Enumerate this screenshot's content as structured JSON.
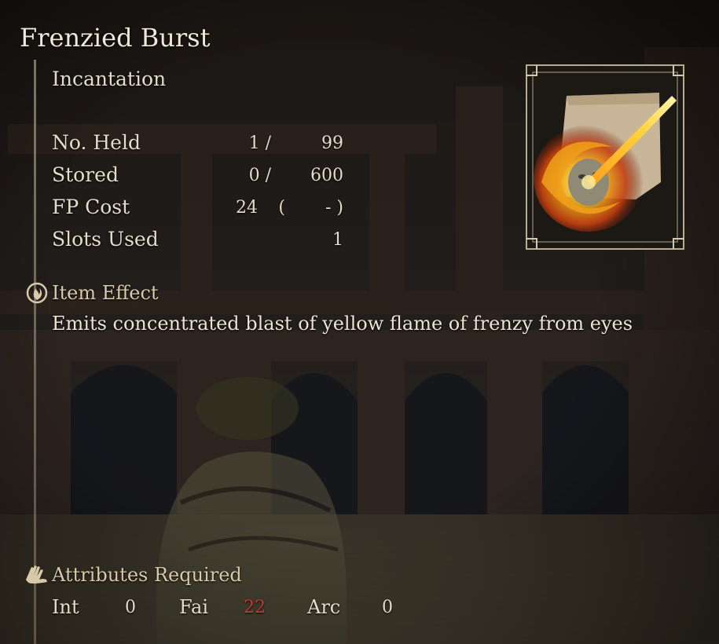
{
  "item": {
    "name": "Frenzied Burst",
    "category": "Incantation"
  },
  "stats": [
    {
      "label": "No. Held",
      "a": "1 /",
      "b": "99"
    },
    {
      "label": "Stored",
      "a": "0 /",
      "b": "600"
    },
    {
      "label": "FP Cost",
      "a": "24",
      "paren_open": "(",
      "b": "- )"
    },
    {
      "label": "Slots Used",
      "a": "",
      "b": "1"
    }
  ],
  "effect": {
    "heading": "Item Effect",
    "icon": "swirl-flame-icon",
    "text": "Emits concentrated blast of yellow flame of frenzy from eyes"
  },
  "attributes": {
    "heading": "Attributes Required",
    "icon": "hand-icon",
    "list": [
      {
        "label": "Int",
        "value": "0"
      },
      {
        "label": "Fai",
        "value": "22"
      },
      {
        "label": "Arc",
        "value": "0"
      }
    ]
  },
  "colors": {
    "text": "#e4dccb",
    "heading": "#d7c9a9",
    "insufficient": "#c63a33"
  }
}
